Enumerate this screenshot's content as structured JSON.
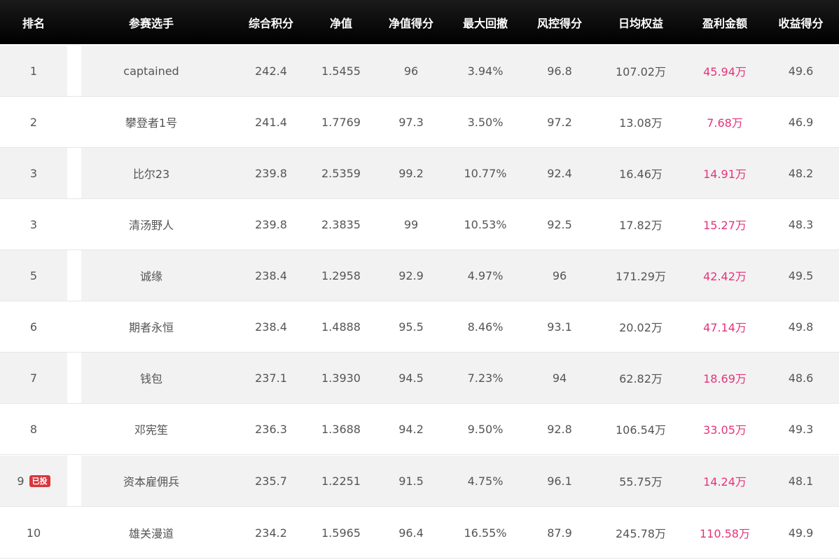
{
  "header": {
    "rank": "排名",
    "name": "参赛选手",
    "total": "综合积分",
    "nav": "净值",
    "nav_score": "净值得分",
    "max_drawdown": "最大回撤",
    "risk_score": "风控得分",
    "daily_equity": "日均权益",
    "profit": "盈利金额",
    "income_score": "收益得分"
  },
  "rows": [
    {
      "rank": "1",
      "name": "captained",
      "total": "242.4",
      "nav": "1.5455",
      "nav_score": "96",
      "max_drawdown": "3.94%",
      "risk_score": "96.8",
      "daily_equity": "107.02万",
      "profit": "45.94万",
      "income_score": "49.6",
      "badge": ""
    },
    {
      "rank": "2",
      "name": "攀登者1号",
      "total": "241.4",
      "nav": "1.7769",
      "nav_score": "97.3",
      "max_drawdown": "3.50%",
      "risk_score": "97.2",
      "daily_equity": "13.08万",
      "profit": "7.68万",
      "income_score": "46.9",
      "badge": ""
    },
    {
      "rank": "3",
      "name": "比尔23",
      "total": "239.8",
      "nav": "2.5359",
      "nav_score": "99.2",
      "max_drawdown": "10.77%",
      "risk_score": "92.4",
      "daily_equity": "16.46万",
      "profit": "14.91万",
      "income_score": "48.2",
      "badge": ""
    },
    {
      "rank": "3",
      "name": "清汤野人",
      "total": "239.8",
      "nav": "2.3835",
      "nav_score": "99",
      "max_drawdown": "10.53%",
      "risk_score": "92.5",
      "daily_equity": "17.82万",
      "profit": "15.27万",
      "income_score": "48.3",
      "badge": ""
    },
    {
      "rank": "5",
      "name": "诚缘",
      "total": "238.4",
      "nav": "1.2958",
      "nav_score": "92.9",
      "max_drawdown": "4.97%",
      "risk_score": "96",
      "daily_equity": "171.29万",
      "profit": "42.42万",
      "income_score": "49.5",
      "badge": ""
    },
    {
      "rank": "6",
      "name": "期者永恒",
      "total": "238.4",
      "nav": "1.4888",
      "nav_score": "95.5",
      "max_drawdown": "8.46%",
      "risk_score": "93.1",
      "daily_equity": "20.02万",
      "profit": "47.14万",
      "income_score": "49.8",
      "badge": ""
    },
    {
      "rank": "7",
      "name": "钱包",
      "total": "237.1",
      "nav": "1.3930",
      "nav_score": "94.5",
      "max_drawdown": "7.23%",
      "risk_score": "94",
      "daily_equity": "62.82万",
      "profit": "18.69万",
      "income_score": "48.6",
      "badge": ""
    },
    {
      "rank": "8",
      "name": "邓宪笙",
      "total": "236.3",
      "nav": "1.3688",
      "nav_score": "94.2",
      "max_drawdown": "9.50%",
      "risk_score": "92.8",
      "daily_equity": "106.54万",
      "profit": "33.05万",
      "income_score": "49.3",
      "badge": ""
    },
    {
      "rank": "9",
      "name": "资本雇佣兵",
      "total": "235.7",
      "nav": "1.2251",
      "nav_score": "91.5",
      "max_drawdown": "4.75%",
      "risk_score": "96.1",
      "daily_equity": "55.75万",
      "profit": "14.24万",
      "income_score": "48.1",
      "badge": "已投"
    },
    {
      "rank": "10",
      "name": "雄关漫道",
      "total": "234.2",
      "nav": "1.5965",
      "nav_score": "96.4",
      "max_drawdown": "16.55%",
      "risk_score": "87.9",
      "daily_equity": "245.78万",
      "profit": "110.58万",
      "income_score": "49.9",
      "badge": ""
    }
  ],
  "colors": {
    "header_bg": "#000000",
    "profit": "#e5337a",
    "badge_bg": "#d9363e",
    "row_alt": "#f2f2f2"
  }
}
